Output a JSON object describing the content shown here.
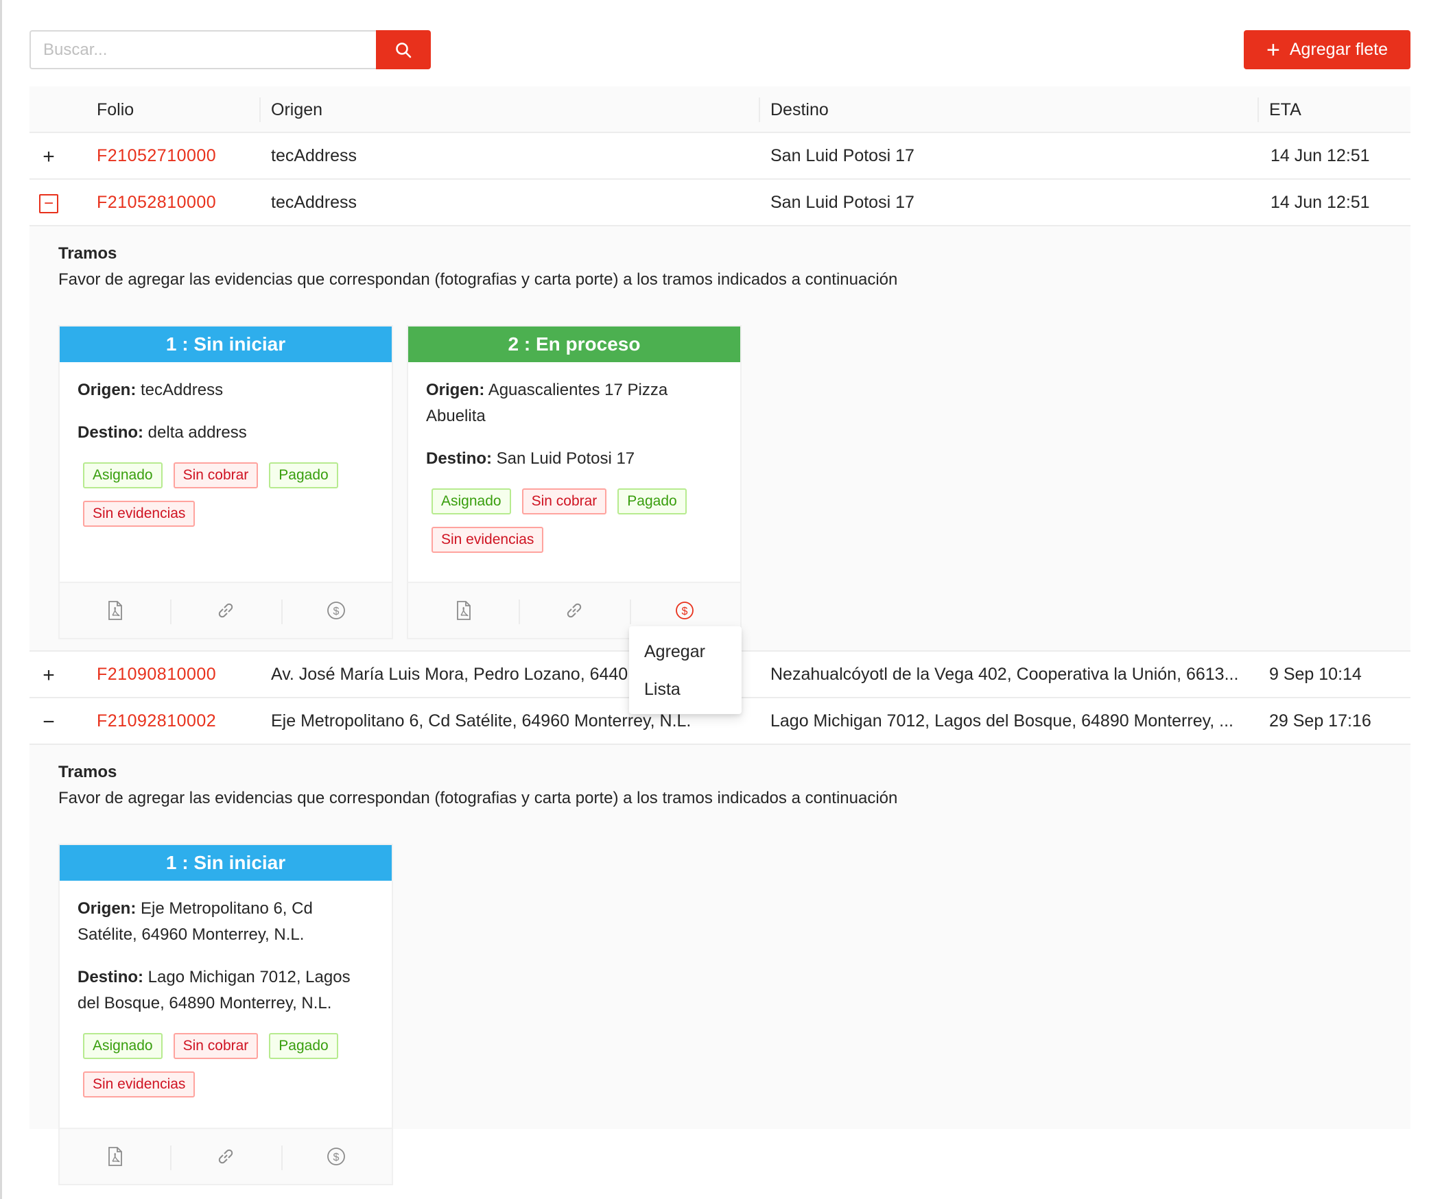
{
  "search": {
    "placeholder": "Buscar...",
    "value": "",
    "button_icon": "search-icon"
  },
  "add_button": {
    "label": "Agregar flete",
    "icon": "plus-icon"
  },
  "colors": {
    "accent": "#e8311c",
    "status_blue": "#2eaeec",
    "status_green": "#4cb050"
  },
  "table": {
    "columns": {
      "folio": "Folio",
      "origen": "Origen",
      "destino": "Destino",
      "eta": "ETA"
    },
    "rows": [
      {
        "folio": "F21052710000",
        "origen": "tecAddress",
        "destino": "San Luid Potosi 17",
        "eta": "14 Jun 12:51",
        "expanded": false
      },
      {
        "folio": "F21052810000",
        "origen": "tecAddress",
        "destino": "San Luid Potosi 17",
        "eta": "14 Jun 12:51",
        "expanded": true
      },
      {
        "folio": "F21090810000",
        "origen": "Av. José María Luis Mora, Pedro Lozano, 6440...",
        "destino": "Nezahualcóyotl de la Vega 402, Cooperativa la Unión, 6613...",
        "eta": "9 Sep 10:14",
        "expanded": false
      },
      {
        "folio": "F21092810002",
        "origen": "Eje Metropolitano 6, Cd Satélite, 64960 Monterrey, N.L.",
        "destino": "Lago Michigan 7012, Lagos del Bosque, 64890 Monterrey, ...",
        "eta": "29 Sep 17:16",
        "expanded": true
      }
    ]
  },
  "expanded_1": {
    "title": "Tramos",
    "description": "Favor de agregar las evidencias que correspondan (fotografias y carta porte) a los tramos indicados a continuación",
    "cards": [
      {
        "header": "1 : Sin iniciar",
        "origen_label": "Origen:",
        "origen": "tecAddress",
        "destino_label": "Destino:",
        "destino": "delta address",
        "tags": [
          "Asignado",
          "Sin cobrar",
          "Pagado",
          "Sin evidencias"
        ]
      },
      {
        "header": "2 : En proceso",
        "origen_label": "Origen:",
        "origen": "Aguascalientes 17 Pizza Abuelita",
        "destino_label": "Destino:",
        "destino": "San Luid Potosi 17",
        "tags": [
          "Asignado",
          "Sin cobrar",
          "Pagado",
          "Sin evidencias"
        ]
      }
    ]
  },
  "expanded_2": {
    "title": "Tramos",
    "description": "Favor de agregar las evidencias que correspondan (fotografias y carta porte) a los tramos indicados a continuación",
    "cards": [
      {
        "header": "1 : Sin iniciar",
        "origen_label": "Origen:",
        "origen": "Eje Metropolitano 6, Cd Satélite, 64960 Monterrey, N.L.",
        "destino_label": "Destino:",
        "destino": "Lago Michigan 7012, Lagos del Bosque, 64890 Monterrey, N.L.",
        "tags": [
          "Asignado",
          "Sin cobrar",
          "Pagado",
          "Sin evidencias"
        ]
      }
    ]
  },
  "card_actions": [
    "pdf-file-icon",
    "link-icon",
    "dollar-circle-icon"
  ],
  "dropdown": {
    "items": [
      "Agregar",
      "Lista"
    ]
  }
}
